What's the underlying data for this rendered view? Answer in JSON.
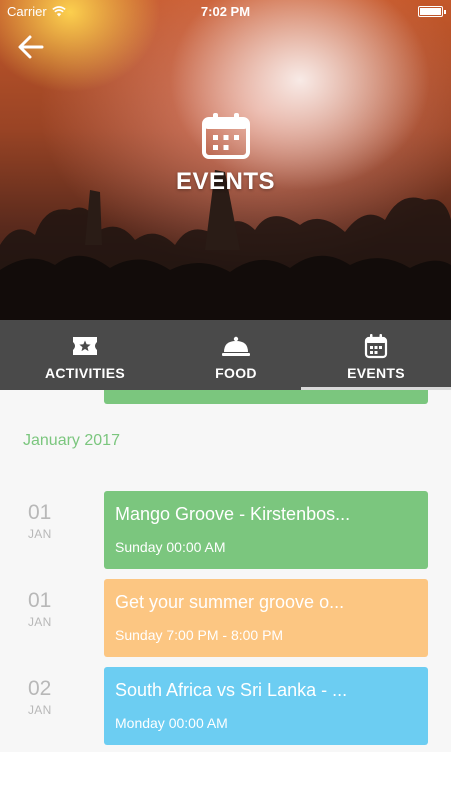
{
  "status_bar": {
    "carrier": "Carrier",
    "time": "7:02 PM"
  },
  "header": {
    "title": "EVENTS",
    "back_icon": "arrow-left-icon",
    "title_icon": "calendar-icon"
  },
  "tabs": [
    {
      "label": "ACTIVITIES",
      "icon": "ticket-star-icon",
      "active": false
    },
    {
      "label": "FOOD",
      "icon": "cloche-icon",
      "active": false
    },
    {
      "label": "EVENTS",
      "icon": "calendar-icon",
      "active": true
    }
  ],
  "month": "January 2017",
  "events": [
    {
      "day": "01",
      "month": "JAN",
      "title": "Mango Groove - Kirstenbos...",
      "time": "Sunday 00:00 AM",
      "color": "#7bc67e"
    },
    {
      "day": "01",
      "month": "JAN",
      "title": "Get your summer groove o...",
      "time": "Sunday 7:00 PM - 8:00 PM",
      "color": "#fcc682"
    },
    {
      "day": "02",
      "month": "JAN",
      "title": "South Africa vs Sri Lanka - ...",
      "time": "Monday 00:00 AM",
      "color": "#6ccdf2"
    }
  ],
  "colors": {
    "tab_bar": "#4a4a4a",
    "month_header": "#7bc67e",
    "content_bg": "#f7f7f7"
  }
}
